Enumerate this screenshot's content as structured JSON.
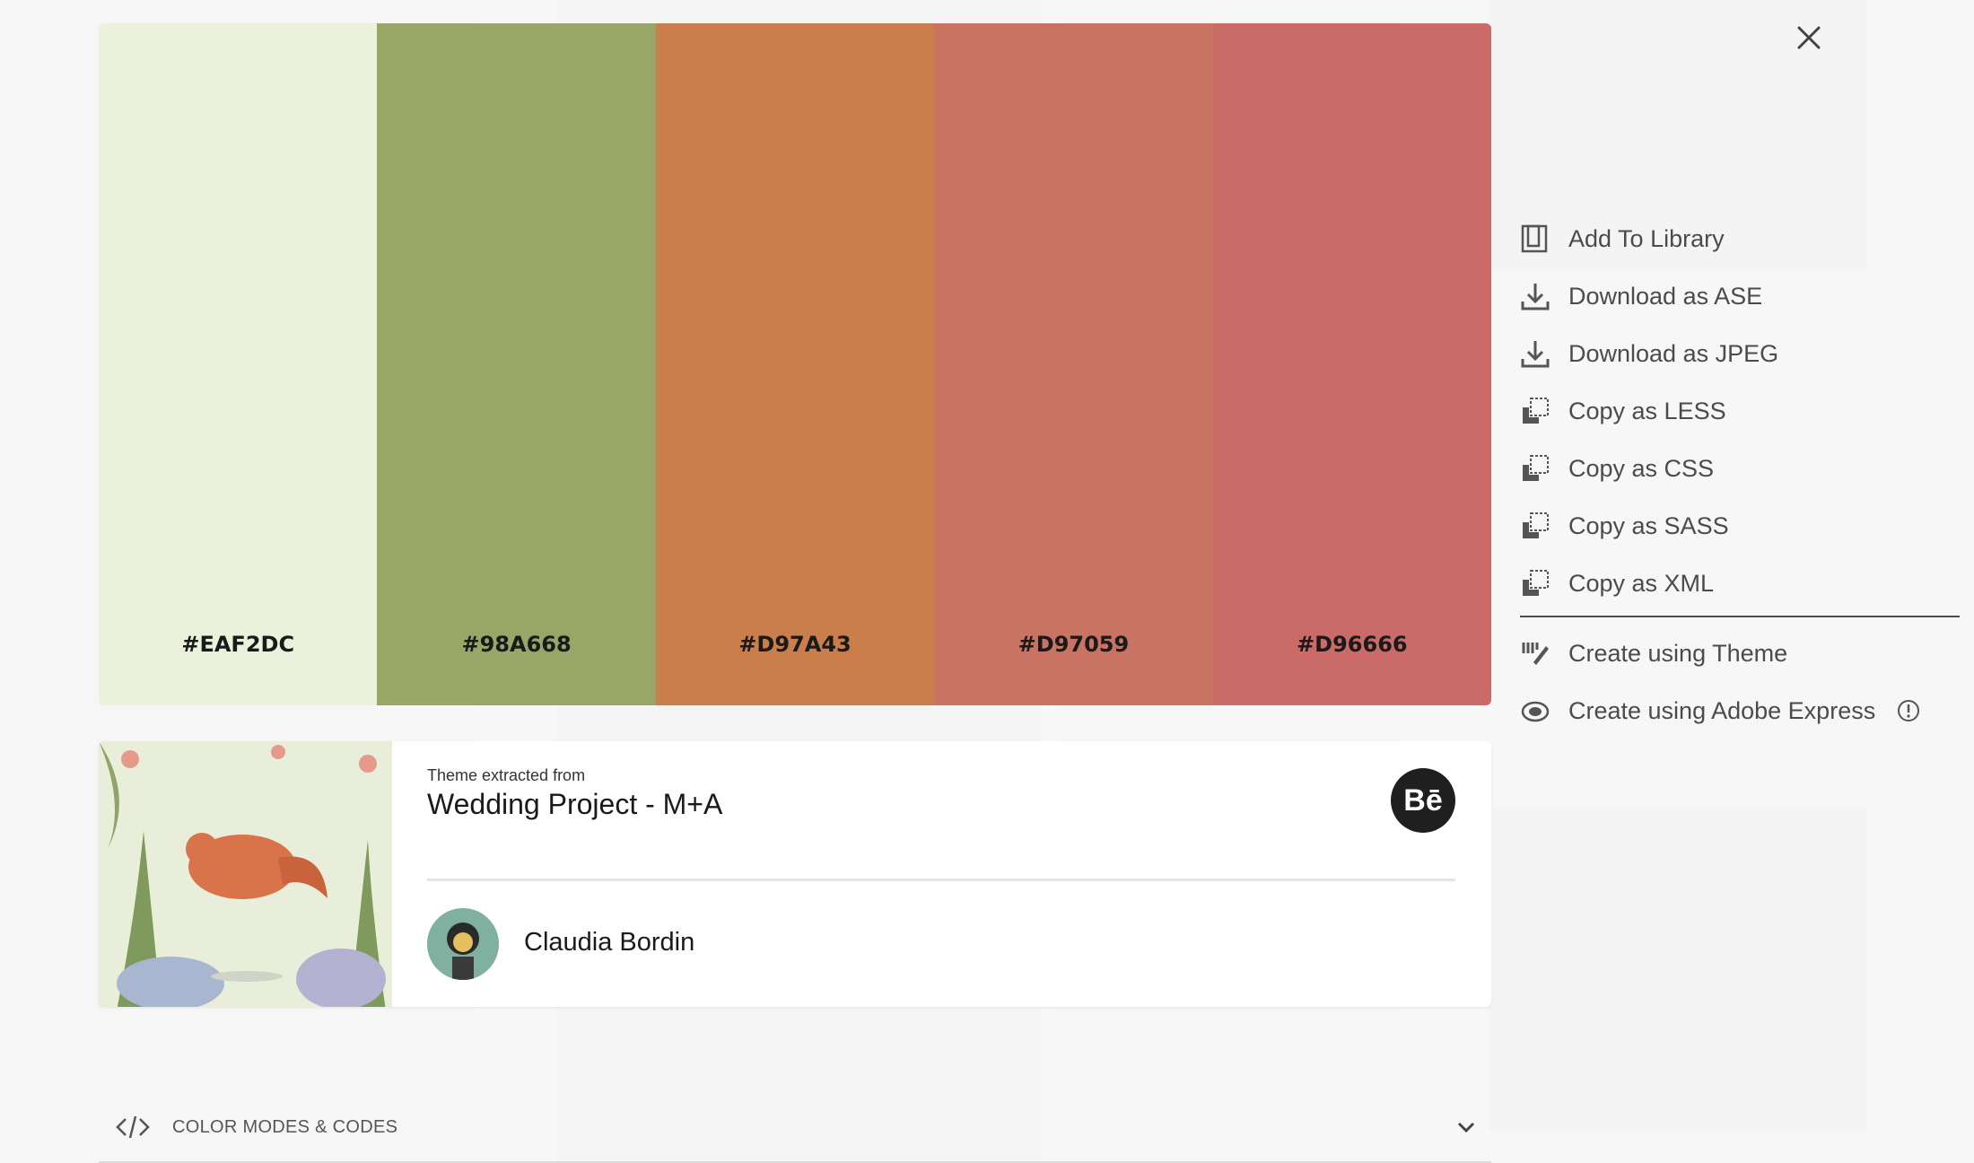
{
  "palette": [
    {
      "code": "#EAF2DC",
      "color": "#EAF2DC"
    },
    {
      "code": "#98A668",
      "color": "#98A668"
    },
    {
      "code": "#D97A43",
      "color": "#C97E4C"
    },
    {
      "code": "#D97059",
      "color": "#C97462"
    },
    {
      "code": "#D96666",
      "color": "#CA6B68"
    }
  ],
  "actions": {
    "add_library": "Add To Library",
    "download_ase": "Download as ASE",
    "download_jpeg": "Download as JPEG",
    "copy_less": "Copy as LESS",
    "copy_css": "Copy as CSS",
    "copy_sass": "Copy as SASS",
    "copy_xml": "Copy as XML",
    "create_theme": "Create using Theme",
    "create_express": "Create using Adobe Express"
  },
  "source": {
    "label": "Theme extracted from",
    "title": "Wedding Project - M+A",
    "behance_label": "Bē",
    "author": "Claudia Bordin"
  },
  "modes": {
    "label": "COLOR MODES & CODES"
  },
  "icons": {
    "close": "close-icon",
    "library": "library-icon",
    "download": "download-icon",
    "copy": "copy-icon",
    "theme": "brush-icon",
    "express": "adobe-express-icon",
    "info": "info-icon",
    "code": "code-icon",
    "chevron": "chevron-down-icon"
  }
}
